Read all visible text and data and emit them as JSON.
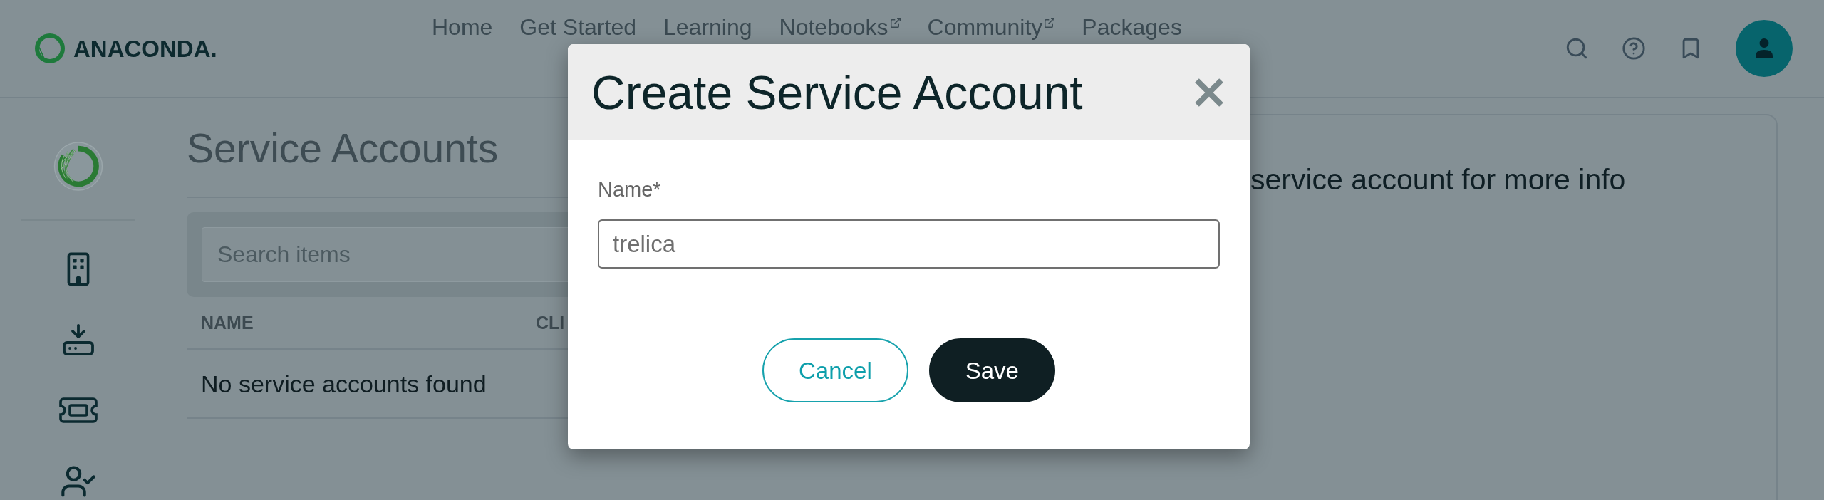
{
  "header": {
    "logo": {
      "text": "ANACONDA."
    },
    "nav": [
      {
        "label": "Home",
        "external": false
      },
      {
        "label": "Get Started",
        "external": false
      },
      {
        "label": "Learning",
        "external": false
      },
      {
        "label": "Notebooks",
        "external": true
      },
      {
        "label": "Community",
        "external": true
      },
      {
        "label": "Packages",
        "external": false
      }
    ]
  },
  "page": {
    "title": "Service Accounts",
    "search": {
      "placeholder": "Search items"
    },
    "table": {
      "columns": [
        "NAME",
        "CLI"
      ],
      "empty_message": "No service accounts found"
    }
  },
  "detail_panel": {
    "message": "service account for more info"
  },
  "dialog": {
    "title": "Create Service Account",
    "fields": [
      {
        "label": "Name*",
        "value": "trelica"
      }
    ],
    "buttons": [
      {
        "label": "Cancel",
        "kind": "secondary"
      },
      {
        "label": "Save",
        "kind": "primary"
      }
    ]
  }
}
